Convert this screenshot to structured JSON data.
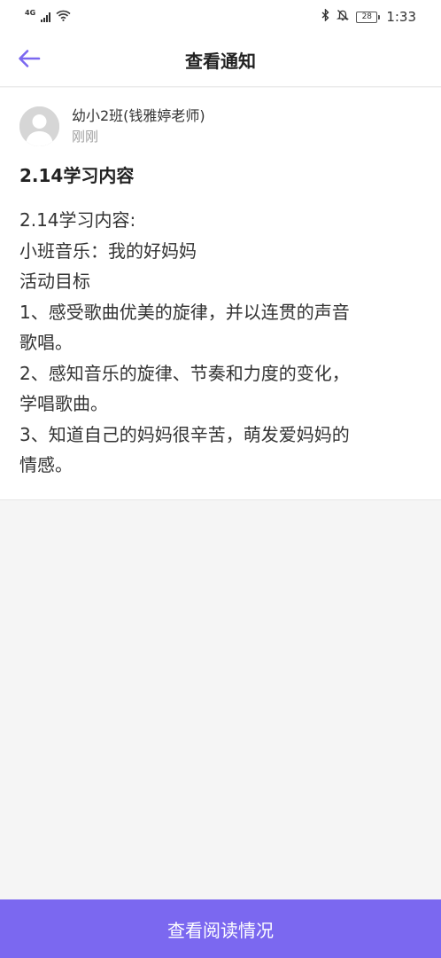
{
  "status_bar": {
    "network": "4G",
    "battery": "28",
    "time": "1:33",
    "icons": [
      "signal-icon",
      "wifi-icon",
      "bluetooth-icon",
      "mute-bell-icon",
      "battery-icon"
    ]
  },
  "header": {
    "title": "查看通知",
    "back_icon": "back-arrow-icon",
    "accent_color": "#7b68f0"
  },
  "notice": {
    "author": "幼小2班(钱雅婷老师)",
    "time": "刚刚",
    "title": "2.14学习内容",
    "lines": [
      "2.14学习内容:",
      "小班音乐：我的好妈妈",
      "活动目标",
      "1、感受歌曲优美的旋律，并以连贯的声音",
      "歌唱。",
      "2、感知音乐的旋律、节奏和力度的变化，",
      "学唱歌曲。",
      "3、知道自己的妈妈很辛苦，萌发爱妈妈的",
      "情感。"
    ]
  },
  "footer": {
    "action_label": "查看阅读情况",
    "button_color": "#7b68f0"
  }
}
